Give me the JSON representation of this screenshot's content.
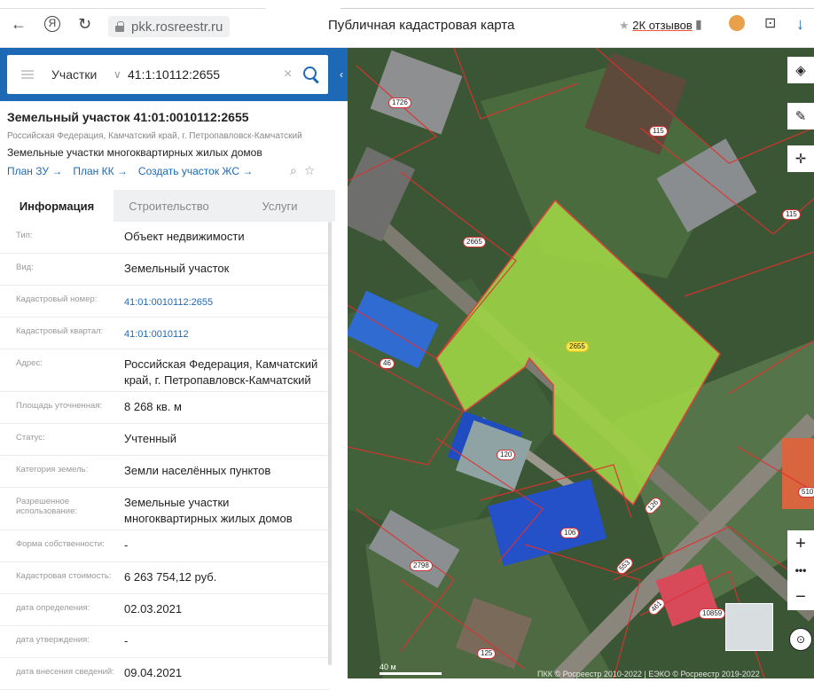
{
  "browser": {
    "url": "pkk.rosreestr.ru",
    "title": "Публичная кадастровая карта",
    "reviews": "2К отзывов"
  },
  "search": {
    "type": "Участки",
    "value": "41:1:10112:2655"
  },
  "parcel": {
    "title": "Земельный участок 41:01:0010112:2655",
    "address_line": "Российская Федерация, Камчатский край, г. Петропавловск-Камчатский",
    "usage_line": "Земельные участки многоквартирных жилых домов",
    "links": [
      "План ЗУ →",
      "План КК →",
      "Создать участок ЖС →"
    ]
  },
  "tabs": [
    "Информация",
    "Строительство",
    "Услуги"
  ],
  "info_rows": [
    {
      "key": "Тип:",
      "value": "Объект недвижимости"
    },
    {
      "key": "Вид:",
      "value": "Земельный участок"
    },
    {
      "key": "Кадастровый номер:",
      "value": "41:01:0010112:2655"
    },
    {
      "key": "Кадастровый квартал:",
      "value": "41:01:0010112"
    },
    {
      "key": "Адрес:",
      "value": "Российская Федерация, Камчатский край, г. Петропавловск-Камчатский"
    },
    {
      "key": "Площадь уточненная:",
      "value": "8 268 кв. м"
    },
    {
      "key": "Статус:",
      "value": "Учтенный"
    },
    {
      "key": "Категория земель:",
      "value": "Земли населённых пунктов"
    },
    {
      "key": "Разрешенное использование:",
      "value": "Земельные участки многоквартирных жилых домов"
    },
    {
      "key": "Форма собственности:",
      "value": "-"
    },
    {
      "key": "Кадастровая стоимость:",
      "value": "6 263 754,12 руб."
    },
    {
      "key": "дата определения:",
      "value": "02.03.2021"
    },
    {
      "key": "дата утверждения:",
      "value": "-"
    },
    {
      "key": "дата внесения сведений:",
      "value": "09.04.2021"
    }
  ],
  "map": {
    "parcel_labels": [
      "1726",
      "115",
      "115",
      "2665",
      "2655",
      "46",
      "120",
      "126",
      "106",
      "2798",
      "553",
      "461",
      "10859",
      "125",
      "510"
    ],
    "footer": "ПКК © Росреестр 2010-2022 | ЕЭКО © Росреестр 2019-2022",
    "scale": "40 м",
    "controls": [
      "layers-icon",
      "ruler-icon",
      "locate-icon",
      "zoom-in",
      "more",
      "zoom-out",
      "compass-icon"
    ]
  },
  "colors": {
    "accent": "#1e69b5",
    "highlight_parcel": "#9fd445"
  }
}
